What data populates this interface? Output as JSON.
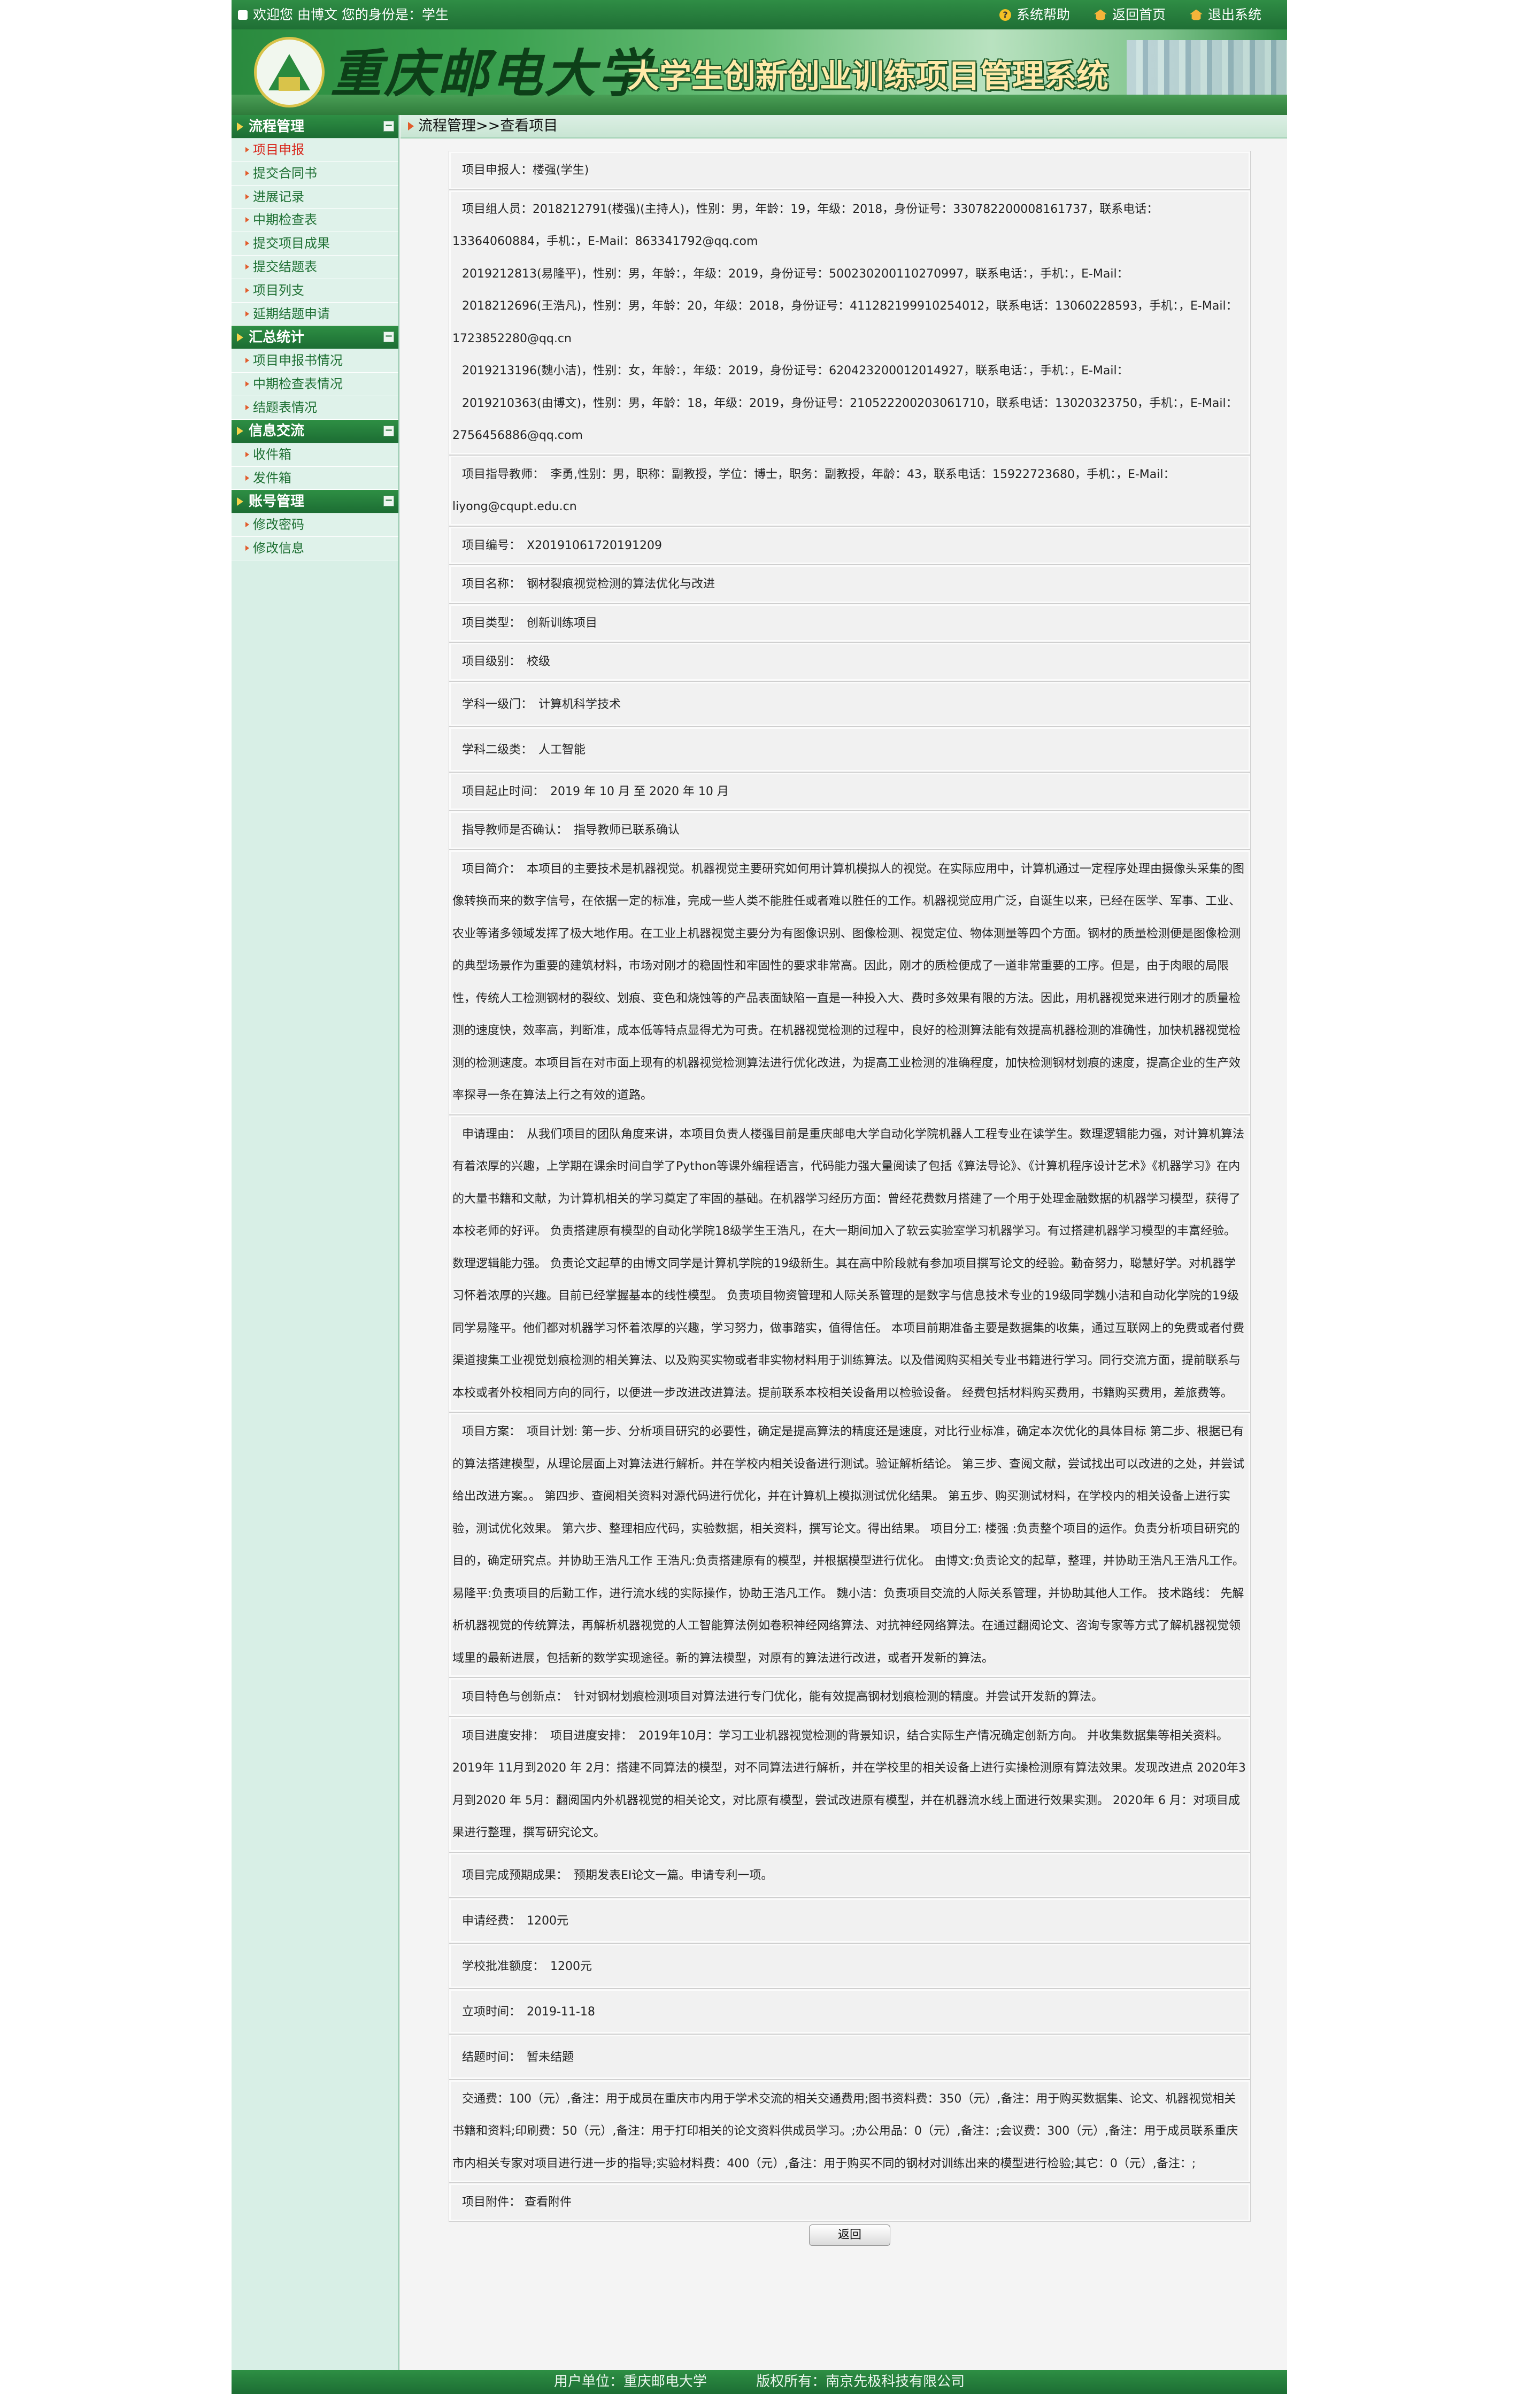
{
  "topbar": {
    "welcome": "欢迎您 由博文 您的身份是：学生",
    "help": "系统帮助",
    "home": "返回首页",
    "logout": "退出系统"
  },
  "banner": {
    "school": "重庆邮电大学",
    "system_title": "大学生创新创业训练项目管理系统"
  },
  "sidebar": {
    "sections": [
      {
        "title": "流程管理",
        "items": [
          "项目申报",
          "提交合同书",
          "进展记录",
          "中期检查表",
          "提交项目成果",
          "提交结题表",
          "项目列支",
          "延期结题申请"
        ]
      },
      {
        "title": "汇总统计",
        "items": [
          "项目申报书情况",
          "中期检查表情况",
          "结题表情况"
        ]
      },
      {
        "title": "信息交流",
        "items": [
          "收件箱",
          "发件箱"
        ]
      },
      {
        "title": "账号管理",
        "items": [
          "修改密码",
          "修改信息"
        ]
      }
    ]
  },
  "breadcrumb": "流程管理>>查看项目",
  "project": {
    "applicant": "项目申报人：楼强(学生)",
    "members": [
      "项目组人员：2018212791(楼强)(主持人)，性别：男，年龄：19，年级：2018，身份证号：330782200008161737，联系电话：13364060884，手机：，E-Mail：863341792@qq.com",
      "2019212813(易隆平)，性别：男，年龄：，年级：2019，身份证号：500230200110270997，联系电话：，手机：，E-Mail：",
      "2018212696(王浩凡)，性别：男，年龄：20，年级：2018，身份证号：411282199910254012，联系电话：13060228593，手机：，E-Mail：1723852280@qq.cn",
      "2019213196(魏小洁)，性别：女，年龄：，年级：2019，身份证号：620423200012014927，联系电话：，手机：，E-Mail：",
      "2019210363(由博文)，性别：男，年龄：18，年级：2019，身份证号：210522200203061710，联系电话：13020323750，手机：，E-Mail：2756456886@qq.com"
    ],
    "advisor": "项目指导教师：　李勇,性别：男，职称：副教授，学位：博士，职务：副教授，年龄：43，联系电话：15922723680，手机：，E-Mail：liyong@cqupt.edu.cn",
    "number": "项目编号：　X20191061720191209",
    "name": "项目名称：　钢材裂痕视觉检测的算法优化与改进",
    "type": "项目类型：　创新训练项目",
    "level": "项目级别：　校级",
    "subject1": "学科一级门：　计算机科学技术",
    "subject2": "学科二级类：　人工智能",
    "period": "项目起止时间：　2019 年 10 月 至 2020 年 10 月",
    "advisor_confirm": "指导教师是否确认：　指导教师已联系确认",
    "intro": "项目简介：　本项目的主要技术是机器视觉。机器视觉主要研究如何用计算机模拟人的视觉。在实际应用中，计算机通过一定程序处理由摄像头采集的图像转换而来的数字信号，在依据一定的标准，完成一些人类不能胜任或者难以胜任的工作。机器视觉应用广泛，自诞生以来，已经在医学、军事、工业、农业等诸多领域发挥了极大地作用。在工业上机器视觉主要分为有图像识别、图像检测、视觉定位、物体测量等四个方面。钢材的质量检测便是图像检测的典型场景作为重要的建筑材料，市场对刚才的稳固性和牢固性的要求非常高。因此，刚才的质检便成了一道非常重要的工序。但是，由于肉眼的局限性，传统人工检测钢材的裂纹、划痕、变色和烧蚀等的产品表面缺陷一直是一种投入大、费时多效果有限的方法。因此，用机器视觉来进行刚才的质量检测的速度快，效率高，判断准，成本低等特点显得尤为可贵。在机器视觉检测的过程中，良好的检测算法能有效提高机器检测的准确性，加快机器视觉检测的检测速度。本项目旨在对市面上现有的机器视觉检测算法进行优化改进，为提高工业检测的准确程度，加快检测钢材划痕的速度，提高企业的生产效率探寻一条在算法上行之有效的道路。",
    "reason": "申请理由：　从我们项目的团队角度来讲，本项目负责人楼强目前是重庆邮电大学自动化学院机器人工程专业在读学生。数理逻辑能力强，对计算机算法有着浓厚的兴趣，上学期在课余时间自学了Python等课外编程语言，代码能力强大量阅读了包括《算法导论》、《计算机程序设计艺术》《机器学习》在内的大量书籍和文献，为计算机相关的学习奠定了牢固的基础。在机器学习经历方面：曾经花费数月搭建了一个用于处理金融数据的机器学习模型，获得了本校老师的好评。 负责搭建原有模型的自动化学院18级学生王浩凡，在大一期间加入了软云实验室学习机器学习。有过搭建机器学习模型的丰富经验。数理逻辑能力强。 负责论文起草的由博文同学是计算机学院的19级新生。其在高中阶段就有参加项目撰写论文的经验。勤奋努力，聪慧好学。对机器学习怀着浓厚的兴趣。目前已经掌握基本的线性模型。 负责项目物资管理和人际关系管理的是数字与信息技术专业的19级同学魏小洁和自动化学院的19级同学易隆平。他们都对机器学习怀着浓厚的兴趣，学习努力，做事踏实，值得信任。 本项目前期准备主要是数据集的收集，通过互联网上的免费或者付费渠道搜集工业视觉划痕检测的相关算法、以及购买实物或者非实物材料用于训练算法。以及借阅购买相关专业书籍进行学习。同行交流方面，提前联系与本校或者外校相同方向的同行，以便进一步改进改进算法。提前联系本校相关设备用以检验设备。 经费包括材料购买费用，书籍购买费用，差旅费等。",
    "plan": "项目方案：　项目计划: 第一步、分析项目研究的必要性，确定是提高算法的精度还是速度，对比行业标准，确定本次优化的具体目标 第二步、根据已有的算法搭建模型，从理论层面上对算法进行解析。并在学校内相关设备进行测试。验证解析结论。 第三步、查阅文献，尝试找出可以改进的之处，并尝试给出改进方案。。 第四步、查阅相关资料对源代码进行优化，并在计算机上模拟测试优化结果。 第五步、购买测试材料，在学校内的相关设备上进行实验，测试优化效果。 第六步、整理相应代码，实验数据，相关资料，撰写论文。得出结果。 项目分工: 楼强 :负责整个项目的运作。负责分析项目研究的目的，确定研究点。并协助王浩凡工作 王浩凡:负责搭建原有的模型，并根据模型进行优化。 由博文:负责论文的起草，整理，并协助王浩凡王浩凡工作。 易隆平:负责项目的后勤工作，进行流水线的实际操作，协助王浩凡工作。 魏小洁：负责项目交流的人际关系管理，并协助其他人工作。 技术路线： 先解析机器视觉的传统算法，再解析机器视觉的人工智能算法例如卷积神经网络算法、对抗神经网络算法。在通过翻阅论文、咨询专家等方式了解机器视觉领域里的最新进展，包括新的数学实现途径。新的算法模型，对原有的算法进行改进，或者开发新的算法。",
    "features": "项目特色与创新点：　针对钢材划痕检测项目对算法进行专门优化，能有效提高钢材划痕检测的精度。并尝试开发新的算法。",
    "schedule": "项目进度安排：　项目进度安排：　2019年10月：学习工业机器视觉检测的背景知识，结合实际生产情况确定创新方向。 并收集数据集等相关资料。 2019年 11月到2020 年 2月：搭建不同算法的模型，对不同算法进行解析，并在学校里的相关设备上进行实操检测原有算法效果。发现改进点 2020年3月到2020 年 5月：翻阅国内外机器视觉的相关论文，对比原有模型，尝试改进原有模型，并在机器流水线上面进行效果实测。 2020年 6 月：对项目成果进行整理，撰写研究论文。",
    "expected": "项目完成预期成果：　预期发表EI论文一篇。申请专利一项。",
    "funding": "申请经费：　1200元",
    "approved": "学校批准额度：　1200元",
    "start_date": "立项时间：　2019-11-18",
    "end_date": "结题时间：　暂未结题",
    "budget": "交通费：100（元）,备注：用于成员在重庆市内用于学术交流的相关交通费用;图书资料费：350（元）,备注：用于购买数据集、论文、机器视觉相关书籍和资料;印刷费：50（元）,备注：用于打印相关的论文资料供成员学习。;办公用品：0（元）,备注：;会议费：300（元）,备注：用于成员联系重庆市内相关专家对项目进行进一步的指导;实验材料费：400（元）,备注：用于购买不同的钢材对训练出来的模型进行检验;其它：0（元）,备注：;",
    "attachment_label": "项目附件：",
    "attachment_link": "查看附件"
  },
  "buttons": {
    "return": "返回"
  },
  "footer": {
    "user_unit": "用户单位：重庆邮电大学",
    "copyright": "版权所有：南京先极科技有限公司"
  }
}
